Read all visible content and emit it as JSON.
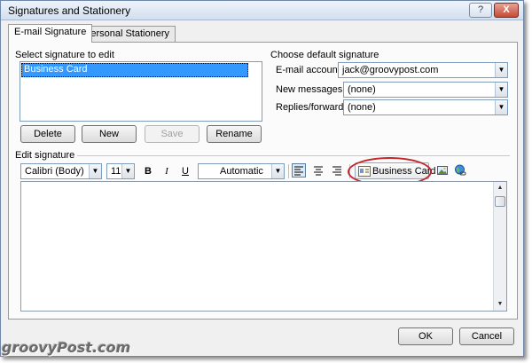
{
  "window": {
    "title": "Signatures and Stationery",
    "close_glyph": "X"
  },
  "tabs": [
    {
      "label": "E-mail Signature",
      "active": true
    },
    {
      "label": "Personal Stationery",
      "active": false
    }
  ],
  "select_signature": {
    "label": "Select signature to edit",
    "items": [
      "Business Card"
    ],
    "selected": "Business Card"
  },
  "signature_buttons": {
    "delete": "Delete",
    "new": "New",
    "save": "Save",
    "rename": "Rename"
  },
  "default_signature": {
    "heading": "Choose default signature",
    "email_account_label": "E-mail account:",
    "email_account_value": "jack@groovypost.com",
    "new_messages_label": "New messages:",
    "new_messages_value": "(none)",
    "replies_label": "Replies/forwards:",
    "replies_value": "(none)"
  },
  "edit_signature": {
    "label": "Edit signature",
    "font": "Calibri (Body)",
    "size": "11",
    "bold": "B",
    "italic": "I",
    "underline": "U",
    "color": "Automatic",
    "business_card": "Business Card"
  },
  "footer": {
    "ok": "OK",
    "cancel": "Cancel"
  },
  "watermark": "groovyPost.com",
  "colors": {
    "accent_ring": "#c0262c",
    "selection": "#3399ff"
  }
}
